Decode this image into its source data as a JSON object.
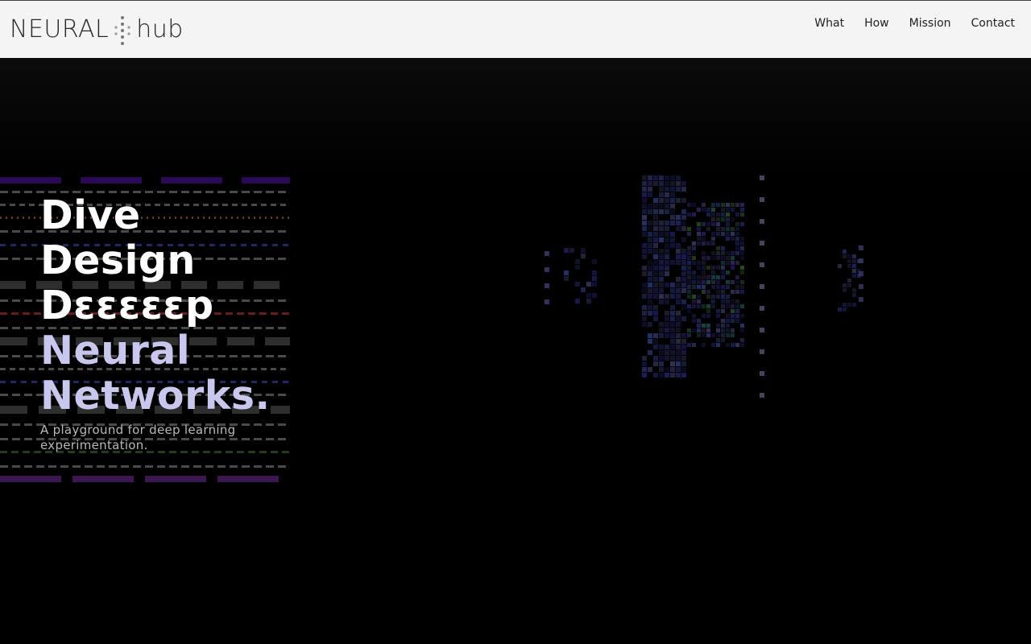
{
  "header": {
    "logo": {
      "left_text": "NEURAL",
      "right_text": "hub",
      "mark_icon": "dots-mark-icon"
    },
    "nav": [
      {
        "label": "What"
      },
      {
        "label": "How"
      },
      {
        "label": "Mission"
      },
      {
        "label": "Contact"
      }
    ]
  },
  "hero": {
    "headline_lines": [
      "Dive",
      "Design",
      "Dεεεεεp",
      "Neural",
      "Networks."
    ],
    "subtitle": "A playground for deep learning experimentation.",
    "colors": {
      "headline_white": "#ffffff",
      "headline_lavender": "#c8c8ee",
      "background": "#000000"
    }
  }
}
